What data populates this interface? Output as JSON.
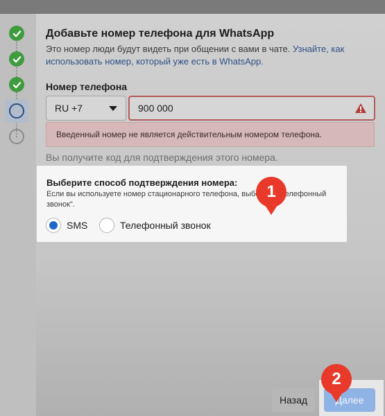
{
  "dialog": {
    "title": "Добавьте номер телефона для WhatsApp",
    "description": "Это номер люди будут видеть при общении с вами в чате. ",
    "description_link": "Узнайте, как использовать номер, который уже есть в WhatsApp.",
    "phone_label": "Номер телефона",
    "country_code": "RU +7",
    "phone_value": "900 000",
    "error_message": "Введенный номер не является действительным номером телефона.",
    "code_note": "Вы получите код для подтверждения этого номера."
  },
  "verification": {
    "title": "Выберите способ подтверждения номера:",
    "description": "Если вы используете номер стационарного телефона, выберите \"Телефонный звонок\".",
    "options": [
      {
        "label": "SMS",
        "selected": true
      },
      {
        "label": "Телефонный звонок",
        "selected": false
      }
    ]
  },
  "badges": {
    "one": "1",
    "two": "2"
  },
  "buttons": {
    "back": "Назад",
    "next": "Далее"
  },
  "steps": [
    {
      "state": "done",
      "icon": "check-icon"
    },
    {
      "state": "done",
      "icon": "check-icon"
    },
    {
      "state": "done",
      "icon": "check-icon"
    },
    {
      "state": "current",
      "icon": "circle-icon"
    },
    {
      "state": "pending",
      "icon": "circle-icon"
    }
  ],
  "colors": {
    "accent": "#1f66c9",
    "success": "#3e9b3e",
    "error": "#b55a5a",
    "badge": "#e8392a"
  }
}
